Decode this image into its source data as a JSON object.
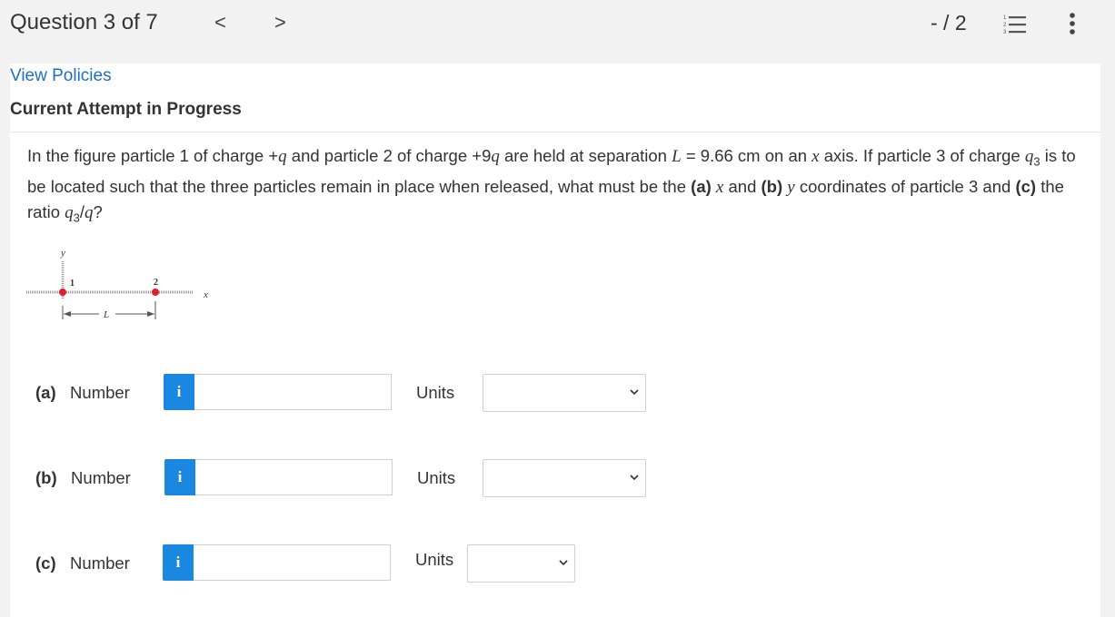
{
  "header": {
    "question_label": "Question 3 of 7",
    "prev_label": "<",
    "next_label": ">",
    "score": "- / 2"
  },
  "links": {
    "view_policies": "View Policies"
  },
  "attempt_status": "Current Attempt in Progress",
  "question": {
    "intro": "In the figure particle 1 of charge +",
    "q": "q",
    "mid1": " and particle 2 of charge +9",
    "mid2": " are held at separation ",
    "L": "L",
    "mid3": " = 9.66 cm on an ",
    "x": "x",
    "mid4": " axis. If particle 3 of charge ",
    "q3": "q",
    "sub3": "3",
    "mid5": " is to be located such that the three particles remain in place when released, what must be the ",
    "a": "(a)",
    "mid6": " and ",
    "b": "(b)",
    "y": "y",
    "mid7": " coordinates of particle 3 and ",
    "c": "(c)",
    "mid8": " the ratio ",
    "end": "?"
  },
  "figure": {
    "y_label": "y",
    "x_label": "x",
    "p1_label": "1",
    "p2_label": "2",
    "L_label": "L",
    "colors": {
      "particle": "#e0202a",
      "axis": "#888888"
    }
  },
  "answers": [
    {
      "part": "(a)",
      "label": "Number",
      "info": "i",
      "value": "",
      "units_label": "Units",
      "units_value": ""
    },
    {
      "part": "(b)",
      "label": "Number",
      "info": "i",
      "value": "",
      "units_label": "Units",
      "units_value": ""
    },
    {
      "part": "(c)",
      "label": "Number",
      "info": "i",
      "value": "",
      "units_label": "Units",
      "units_value": ""
    }
  ],
  "colors": {
    "accent": "#1a87e0",
    "link": "#1e6fbf"
  }
}
